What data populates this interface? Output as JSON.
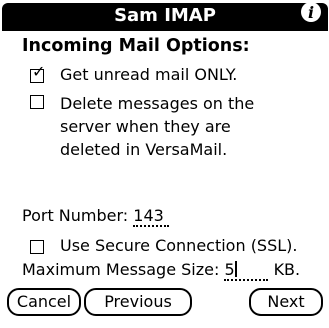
{
  "window": {
    "title": "Sam IMAP",
    "info_glyph": "i"
  },
  "section": {
    "heading": "Incoming Mail Options:"
  },
  "options": {
    "get_unread": {
      "label": "Get unread mail ONLY.",
      "checked": true
    },
    "delete_on_server": {
      "lines": [
        "Delete messages on the",
        "server when they are",
        "deleted in VersaMail."
      ],
      "checked": false
    }
  },
  "port": {
    "label": "Port Number:",
    "value": "143"
  },
  "ssl": {
    "label": "Use Secure Connection (SSL).",
    "checked": false
  },
  "max_size": {
    "label": "Maximum Message Size:",
    "value": "5",
    "unit": "KB."
  },
  "buttons": {
    "cancel": "Cancel",
    "previous": "Previous",
    "next": "Next"
  },
  "icons": {
    "checkmark": "checkmark-icon",
    "info": "info-icon"
  }
}
